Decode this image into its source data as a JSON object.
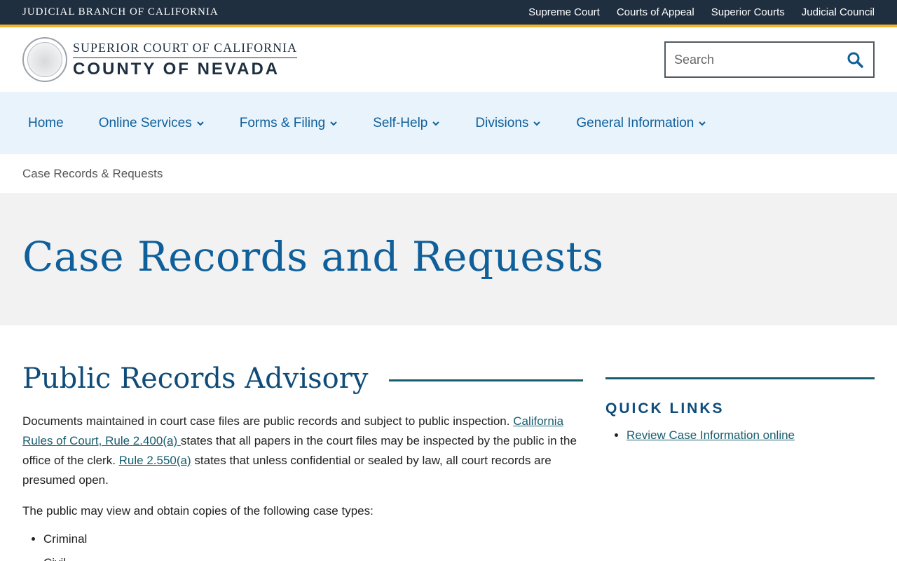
{
  "topbar": {
    "brand": "JUDICIAL BRANCH OF CALIFORNIA",
    "links": [
      "Supreme Court",
      "Courts of Appeal",
      "Superior Courts",
      "Judicial Council"
    ]
  },
  "header": {
    "logo_line1": "SUPERIOR COURT OF CALIFORNIA",
    "logo_line2": "COUNTY OF NEVADA",
    "search_placeholder": "Search"
  },
  "nav": {
    "items": [
      {
        "label": "Home",
        "dropdown": false
      },
      {
        "label": "Online Services",
        "dropdown": true
      },
      {
        "label": "Forms & Filing",
        "dropdown": true
      },
      {
        "label": "Self-Help",
        "dropdown": true
      },
      {
        "label": "Divisions",
        "dropdown": true
      },
      {
        "label": "General Information",
        "dropdown": true
      }
    ]
  },
  "breadcrumb": "Case Records & Requests",
  "hero": {
    "title": "Case Records and Requests"
  },
  "main": {
    "section_title": "Public Records Advisory",
    "para1_text1": "Documents maintained in court case files are public records and subject to public inspection. ",
    "para1_link1": "California Rules of Court, Rule 2.400(a) ",
    "para1_text2": "states that all papers in the court files may be inspected by the public in the office of the clerk. ",
    "para1_link2": "Rule 2.550(a)",
    "para1_text3": " states that unless confidential or sealed by law, all court records are presumed open.",
    "para2": "The public may view and obtain copies of the following case types:",
    "case_types": [
      "Criminal",
      "Civil"
    ]
  },
  "sidebar": {
    "title": "QUICK LINKS",
    "links": [
      "Review Case Information online"
    ]
  },
  "colors": {
    "topbar": "#1f2f3f",
    "gold": "#f0b42d",
    "nav_bg": "#e9f3fb",
    "link_blue": "#0f5f9b",
    "teal": "#175d6e"
  }
}
